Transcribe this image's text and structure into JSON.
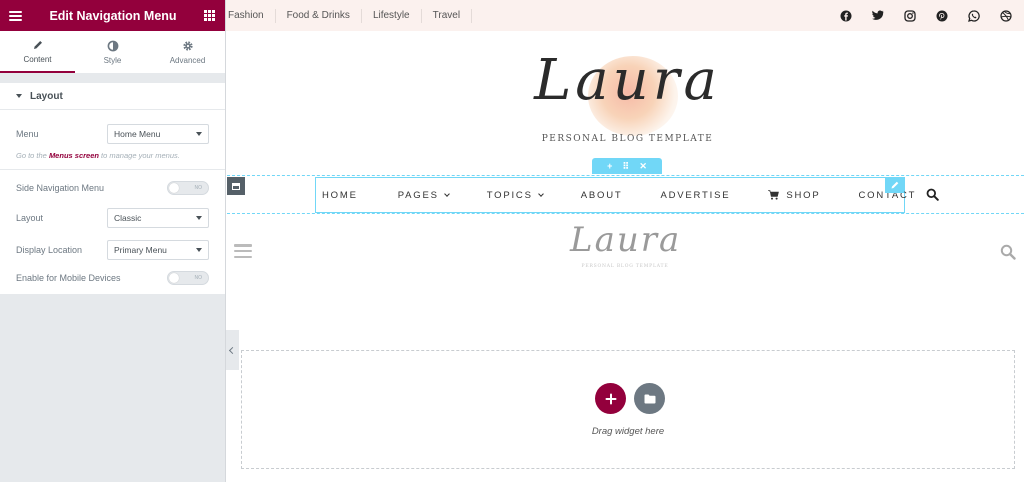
{
  "panel": {
    "title": "Edit Navigation Menu",
    "tabs": [
      {
        "label": "Content",
        "icon": "pencil-icon",
        "active": true
      },
      {
        "label": "Style",
        "icon": "contrast-icon",
        "active": false
      },
      {
        "label": "Advanced",
        "icon": "gear-icon",
        "active": false
      }
    ],
    "section": {
      "title": "Layout",
      "menu_label": "Menu",
      "menu_value": "Home Menu",
      "hint_prefix": "Go to the ",
      "hint_link": "Menus screen",
      "hint_suffix": " to manage your menus.",
      "side_nav_label": "Side Navigation Menu",
      "side_nav_toggle": "NO",
      "layout_label": "Layout",
      "layout_value": "Classic",
      "location_label": "Display Location",
      "location_value": "Primary Menu",
      "mobile_label": "Enable for Mobile Devices",
      "mobile_toggle": "NO"
    }
  },
  "topbar": {
    "categories": [
      "Fashion",
      "Food & Drinks",
      "Lifestyle",
      "Travel"
    ],
    "socials": [
      "facebook-icon",
      "twitter-icon",
      "instagram-icon",
      "pinterest-icon",
      "whatsapp-icon",
      "dribbble-icon"
    ]
  },
  "logo": {
    "text": "Laura",
    "tagline": "PERSONAL BLOG TEMPLATE"
  },
  "nav": {
    "items": [
      {
        "label": "HOME",
        "dropdown": false
      },
      {
        "label": "PAGES",
        "dropdown": true
      },
      {
        "label": "TOPICS",
        "dropdown": true
      },
      {
        "label": "ABOUT",
        "dropdown": false
      },
      {
        "label": "ADVERTISE",
        "dropdown": false
      },
      {
        "label": "SHOP",
        "dropdown": false,
        "icon": "cart-icon"
      },
      {
        "label": "CONTACT",
        "dropdown": false
      }
    ]
  },
  "mobile": {
    "logo_text": "Laura",
    "tagline": "PERSONAL BLOG TEMPLATE"
  },
  "dropzone": {
    "label": "Drag widget here"
  },
  "colors": {
    "accent": "#93003c",
    "edit_outline": "#71d7f7",
    "panel_bg": "#e6e9ec"
  }
}
